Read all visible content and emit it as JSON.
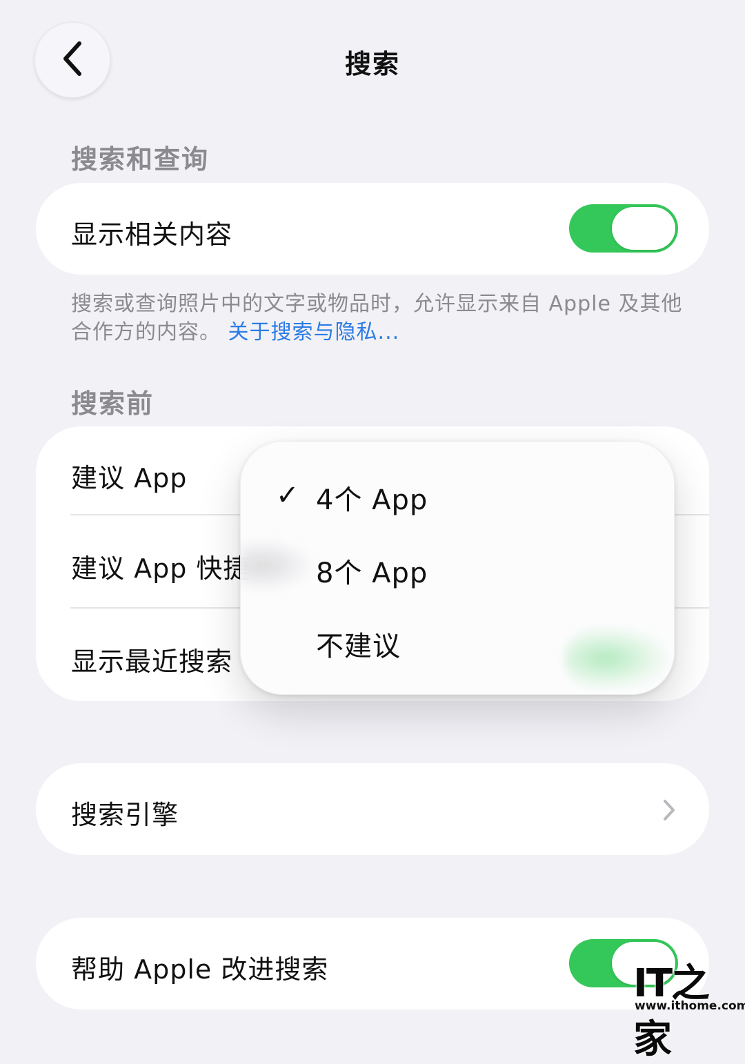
{
  "header": {
    "title": "搜索"
  },
  "sections": {
    "search_and_query": {
      "header": "搜索和查询",
      "show_related_label": "显示相关内容",
      "show_related_on": true,
      "footer_text": "搜索或查询照片中的文字或物品时，允许显示来自 Apple 及其他合作方的内容。",
      "footer_link": "关于搜索与隐私..."
    },
    "before_search": {
      "header": "搜索前",
      "rows": [
        {
          "label": "建议 App"
        },
        {
          "label": "建议 App 快捷"
        },
        {
          "label": "显示最近搜索"
        }
      ]
    },
    "search_engine": {
      "label": "搜索引擎"
    },
    "improve": {
      "label": "帮助 Apple 改进搜索",
      "on": true
    }
  },
  "popup_menu": {
    "items": [
      {
        "label": "4个 App",
        "checked": true
      },
      {
        "label": "8个 App",
        "checked": false
      },
      {
        "label": "不建议",
        "checked": false
      }
    ],
    "check_glyph": "✓"
  },
  "watermark": {
    "logo": "IT之家",
    "url": "www.ithome.com"
  },
  "colors": {
    "background": "#F2F1F6",
    "toggle_on": "#34C759",
    "link": "#2A7BE4",
    "secondary_text": "#8A8A8F"
  }
}
